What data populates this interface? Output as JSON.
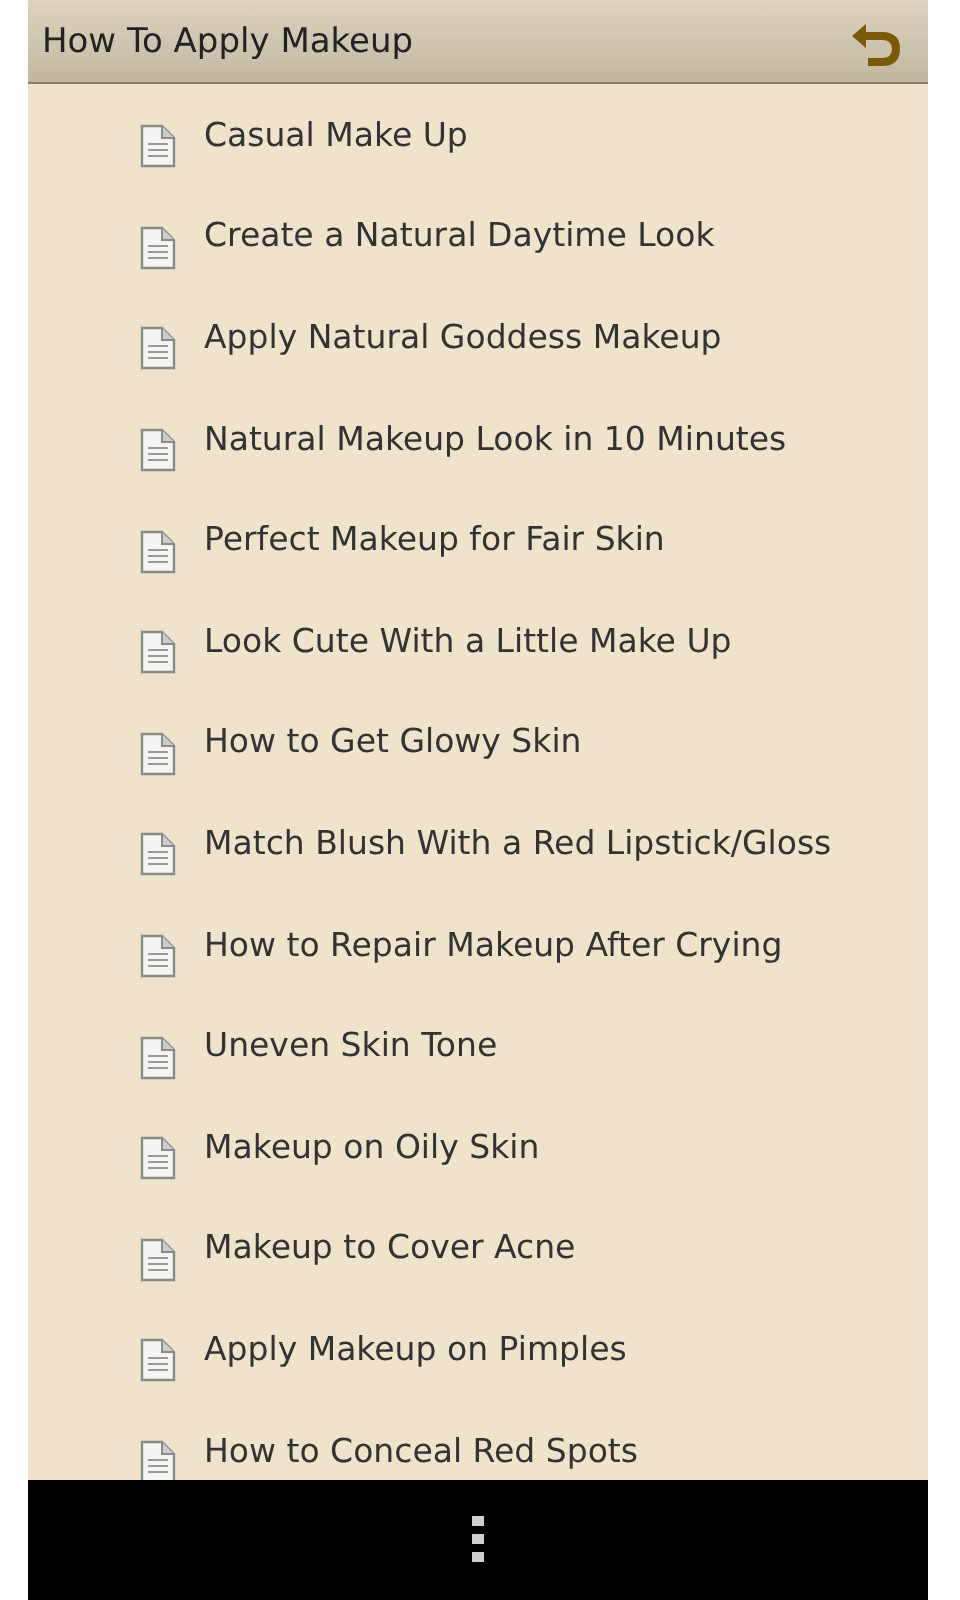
{
  "window": {
    "title": "How To Apply Makeup"
  },
  "items": [
    {
      "label": "Casual Make Up"
    },
    {
      "label": "Create a Natural Daytime Look"
    },
    {
      "label": "Apply Natural Goddess Makeup"
    },
    {
      "label": "Natural Makeup Look in 10 Minutes"
    },
    {
      "label": "Perfect Makeup for Fair Skin"
    },
    {
      "label": "Look Cute With a Little Make Up"
    },
    {
      "label": "How to Get Glowy Skin"
    },
    {
      "label": "Match Blush With a Red Lipstick/Gloss"
    },
    {
      "label": "How to Repair Makeup After Crying"
    },
    {
      "label": "Uneven Skin Tone"
    },
    {
      "label": "Makeup on Oily Skin"
    },
    {
      "label": "Makeup to Cover Acne"
    },
    {
      "label": "Apply Makeup on Pimples"
    },
    {
      "label": "How to Conceal Red Spots"
    }
  ]
}
